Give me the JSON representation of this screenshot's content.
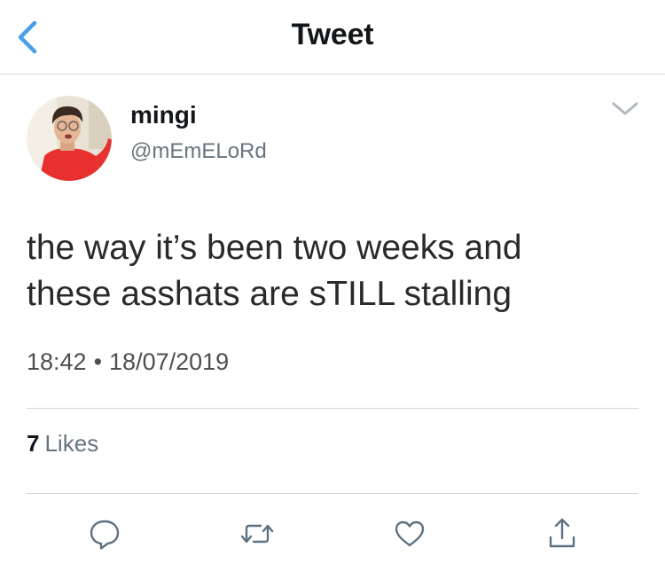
{
  "header": {
    "title": "Tweet",
    "back_icon": "chevron-left-icon",
    "accent_color": "#4a9fe8"
  },
  "author": {
    "display_name": "mingi",
    "handle": "@mEmELoRd",
    "avatar": "profile-photo"
  },
  "tweet": {
    "lines": [
      "the way it’s been two weeks and",
      "these asshats are sTILL stalling"
    ],
    "time": "18:42",
    "separator": "•",
    "date": "18/07/2019"
  },
  "engagement": {
    "likes_count": "7",
    "likes_label": "Likes"
  },
  "actions": {
    "reply_icon": "reply-icon",
    "retweet_icon": "retweet-icon",
    "like_icon": "heart-icon",
    "share_icon": "share-icon",
    "icon_color": "#5f7181"
  }
}
